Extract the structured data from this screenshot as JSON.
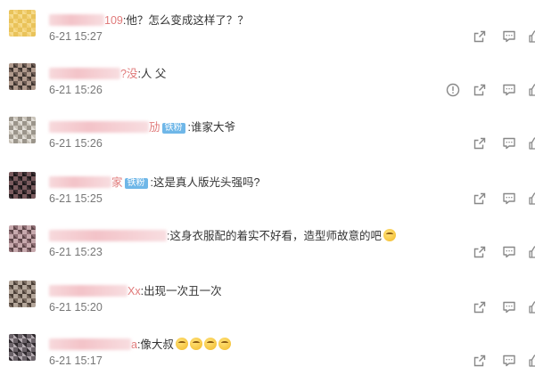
{
  "comments": [
    {
      "name_tail": "109",
      "fan_badge": "",
      "text": ":他？怎么变成这样了？？",
      "emojis": 0,
      "time": "6-21 15:27",
      "report": false,
      "avatar": [
        "#f2cf74",
        "#e9c35a",
        "#f6db8c"
      ]
    },
    {
      "name_tail": "?没",
      "fan_badge": "",
      "text": ":人 父",
      "emojis": 0,
      "time": "6-21 15:26",
      "report": true,
      "avatar": [
        "#6e5d55",
        "#b09a8d",
        "#3e342f"
      ]
    },
    {
      "name_tail": "劢",
      "fan_badge": "铁粉",
      "text": ":谁家大爷",
      "emojis": 0,
      "time": "6-21 15:26",
      "report": false,
      "avatar": [
        "#c8c2b8",
        "#9b958b",
        "#e1ddd6"
      ]
    },
    {
      "name_tail": "家",
      "fan_badge": "铁粉",
      "text": ":这是真人版光头强吗?",
      "emojis": 0,
      "time": "6-21 15:25",
      "report": false,
      "avatar": [
        "#3a2e31",
        "#7a5b5e",
        "#1d1719"
      ]
    },
    {
      "name_tail": "",
      "fan_badge": "",
      "text": ":这身衣服配的着实不好看，造型师故意的吧",
      "emojis": 1,
      "time": "6-21 15:23",
      "report": false,
      "avatar": [
        "#8f6f75",
        "#c7a9ad",
        "#5e4649"
      ]
    },
    {
      "name_tail": "Xx",
      "fan_badge": "",
      "text": ":出现一次丑一次",
      "emojis": 0,
      "time": "6-21 15:20",
      "report": false,
      "avatar": [
        "#7d6e63",
        "#b4a69a",
        "#4b3f37"
      ]
    },
    {
      "name_tail": "a",
      "fan_badge": "",
      "text": ":像大叔",
      "emojis": 4,
      "time": "6-21 15:17",
      "report": false,
      "avatar": [
        "#2f2a2e",
        "#6a6268",
        "#b3aab0"
      ]
    }
  ],
  "icons": {
    "report": "report-icon",
    "forward": "forward-icon",
    "comment": "comment-icon"
  },
  "colors": {
    "fan_badge": "#6fb7e8",
    "name_tail": "#e07a7a",
    "time": "#777777",
    "icon": "#888888"
  }
}
